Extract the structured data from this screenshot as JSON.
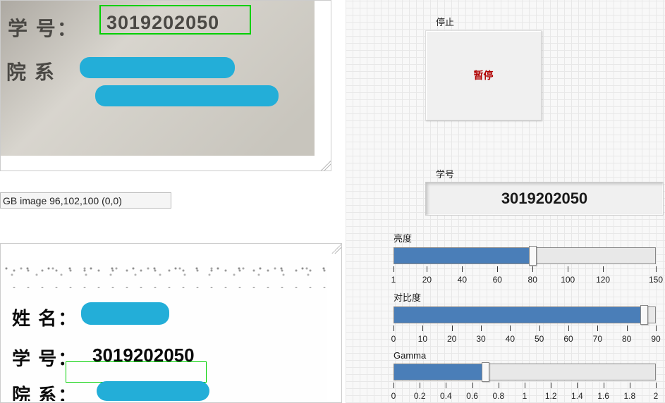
{
  "top_image": {
    "field1_label": "学 号：",
    "field1_value": "3019202050",
    "field2_label": "院 系"
  },
  "statusbar": "GB image 96,102,100   (0,0)",
  "bottom_image": {
    "row1_label": "姓 名：",
    "row2_label": "学 号：",
    "row2_value": "3019202050",
    "row3_label": "院 系："
  },
  "stop": {
    "label": "停止",
    "button": "暂停"
  },
  "student_id": {
    "label": "学号",
    "value": "3019202050"
  },
  "sliders": {
    "brightness": {
      "label": "亮度",
      "value": 80,
      "min": 1,
      "max": 150,
      "ticks": [
        1,
        20,
        40,
        60,
        80,
        100,
        120,
        150
      ]
    },
    "contrast": {
      "label": "对比度",
      "value": 86,
      "min": 0,
      "max": 90,
      "ticks": [
        0,
        10,
        20,
        30,
        40,
        50,
        60,
        70,
        80,
        90
      ]
    },
    "gamma": {
      "label": "Gamma",
      "value": 0.7,
      "min": 0,
      "max": 2,
      "ticks": [
        0,
        0.2,
        0.4,
        0.6,
        0.8,
        1,
        1.2,
        1.4,
        1.6,
        1.8,
        2
      ]
    }
  }
}
